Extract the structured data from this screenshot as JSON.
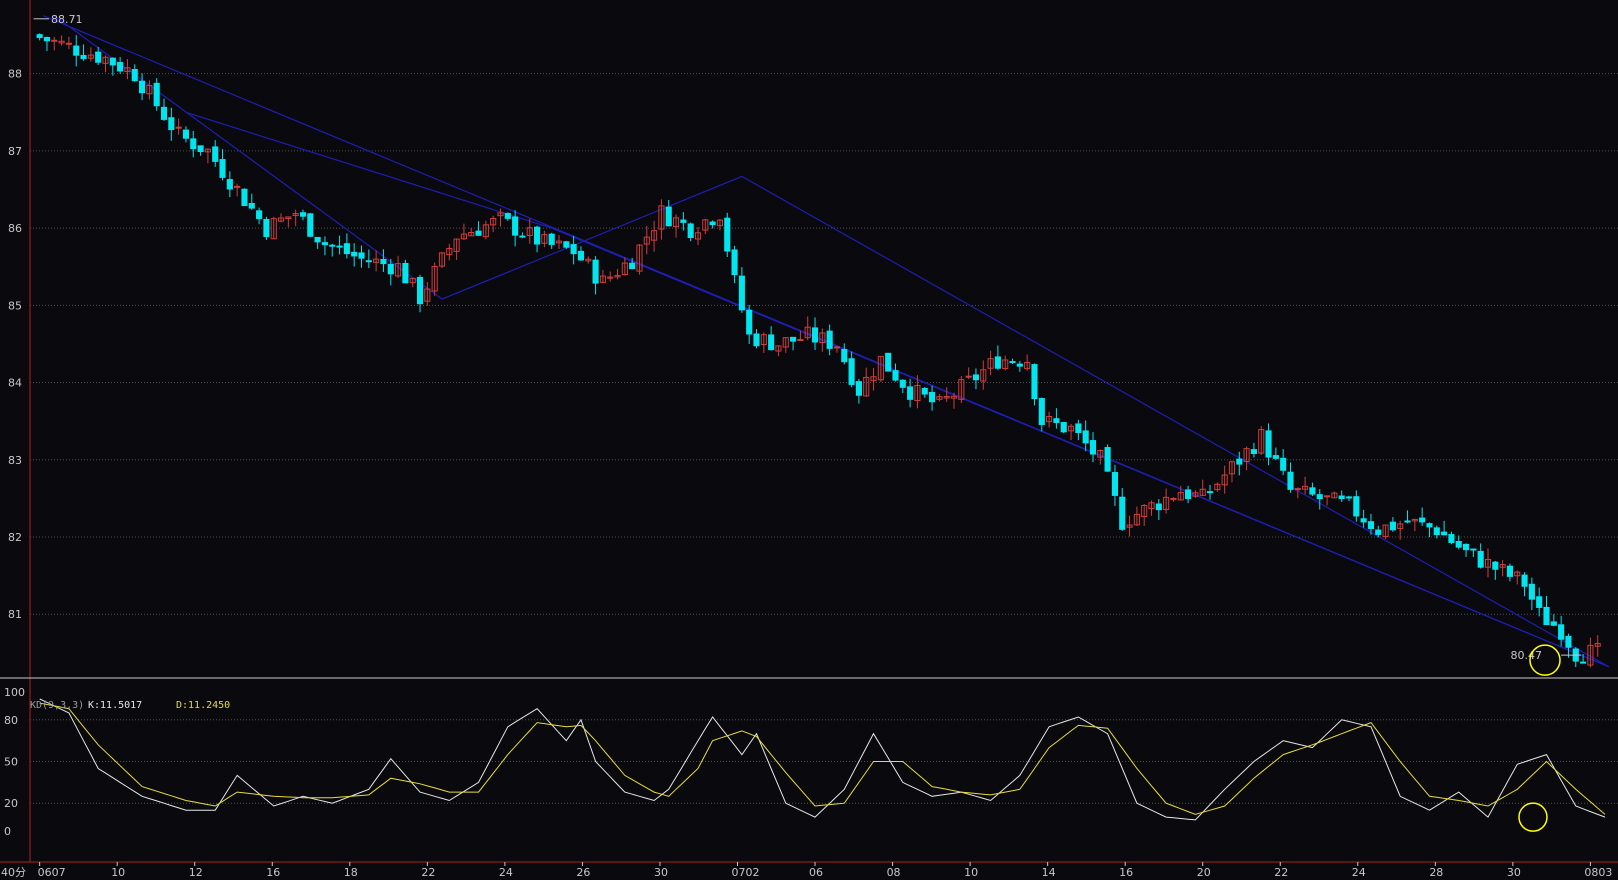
{
  "chart_data": {
    "type": "candlestick",
    "price_panel": {
      "ylim": [
        80.2,
        88.85
      ],
      "y_ticks": [
        81,
        82,
        83,
        84,
        85,
        86,
        87,
        88
      ],
      "annotations": {
        "high_label": "88.71",
        "low_label": "80.47"
      }
    },
    "x_ticks": [
      "0607",
      "10",
      "12",
      "16",
      "18",
      "22",
      "24",
      "26",
      "30",
      "0702",
      "06",
      "08",
      "10",
      "14",
      "16",
      "20",
      "22",
      "24",
      "28",
      "30",
      "0803"
    ],
    "period_label": "40分",
    "price_path": [
      [
        0,
        88.5
      ],
      [
        10,
        88.2
      ],
      [
        14,
        88.0
      ],
      [
        20,
        87.2
      ],
      [
        24,
        87.0
      ],
      [
        28,
        86.5
      ],
      [
        32,
        86.0
      ],
      [
        36,
        86.2
      ],
      [
        40,
        85.8
      ],
      [
        45,
        85.6
      ],
      [
        50,
        85.5
      ],
      [
        53,
        85.1
      ],
      [
        58,
        85.9
      ],
      [
        64,
        86.1
      ],
      [
        70,
        85.8
      ],
      [
        74,
        85.7
      ],
      [
        78,
        85.3
      ],
      [
        82,
        85.6
      ],
      [
        86,
        86.2
      ],
      [
        90,
        86.0
      ],
      [
        94,
        86.2
      ],
      [
        96,
        85.3
      ],
      [
        98,
        84.6
      ],
      [
        102,
        84.5
      ],
      [
        106,
        84.6
      ],
      [
        110,
        84.5
      ],
      [
        113,
        83.9
      ],
      [
        116,
        84.3
      ],
      [
        120,
        83.9
      ],
      [
        124,
        83.7
      ],
      [
        128,
        84.0
      ],
      [
        132,
        84.3
      ],
      [
        136,
        84.3
      ],
      [
        138,
        83.5
      ],
      [
        142,
        83.4
      ],
      [
        146,
        83.0
      ],
      [
        149,
        82.2
      ],
      [
        153,
        82.4
      ],
      [
        157,
        82.6
      ],
      [
        160,
        82.5
      ],
      [
        164,
        82.9
      ],
      [
        168,
        83.3
      ],
      [
        172,
        82.6
      ],
      [
        176,
        82.5
      ],
      [
        180,
        82.4
      ],
      [
        184,
        82.1
      ],
      [
        188,
        82.2
      ],
      [
        192,
        82.1
      ],
      [
        196,
        81.8
      ],
      [
        200,
        81.6
      ],
      [
        204,
        81.4
      ],
      [
        206,
        81.0
      ],
      [
        209,
        80.8
      ],
      [
        211,
        80.5
      ]
    ],
    "trendlines": [
      [
        [
          0.5,
          88.75
        ],
        [
          214.5,
          80.32
        ]
      ],
      [
        [
          2,
          88.75
        ],
        [
          55,
          85.08
        ],
        [
          96,
          86.67
        ],
        [
          214.5,
          80.32
        ]
      ],
      [
        [
          20,
          87.5
        ],
        [
          70,
          86.0
        ],
        [
          214.5,
          80.32
        ]
      ]
    ],
    "kd_panel": {
      "label": "KD(9,3,3)",
      "k_label": "K:11.5017",
      "d_label": "D:11.2450",
      "y_ticks": [
        0,
        20,
        50,
        80,
        100
      ],
      "ylim": [
        -5,
        100
      ],
      "k_path": [
        [
          0,
          95
        ],
        [
          4,
          85
        ],
        [
          8,
          45
        ],
        [
          14,
          25
        ],
        [
          20,
          15
        ],
        [
          24,
          15
        ],
        [
          27,
          40
        ],
        [
          32,
          18
        ],
        [
          36,
          25
        ],
        [
          40,
          20
        ],
        [
          45,
          30
        ],
        [
          48,
          52
        ],
        [
          52,
          28
        ],
        [
          56,
          22
        ],
        [
          60,
          35
        ],
        [
          64,
          75
        ],
        [
          68,
          88
        ],
        [
          72,
          65
        ],
        [
          74,
          80
        ],
        [
          76,
          50
        ],
        [
          80,
          28
        ],
        [
          84,
          22
        ],
        [
          86,
          30
        ],
        [
          90,
          65
        ],
        [
          92,
          82
        ],
        [
          96,
          55
        ],
        [
          98,
          70
        ],
        [
          102,
          20
        ],
        [
          106,
          10
        ],
        [
          110,
          30
        ],
        [
          114,
          70
        ],
        [
          118,
          35
        ],
        [
          122,
          25
        ],
        [
          126,
          28
        ],
        [
          130,
          22
        ],
        [
          134,
          40
        ],
        [
          138,
          75
        ],
        [
          142,
          82
        ],
        [
          146,
          70
        ],
        [
          150,
          20
        ],
        [
          154,
          10
        ],
        [
          158,
          8
        ],
        [
          162,
          30
        ],
        [
          166,
          50
        ],
        [
          170,
          65
        ],
        [
          174,
          60
        ],
        [
          178,
          80
        ],
        [
          182,
          75
        ],
        [
          186,
          25
        ],
        [
          190,
          15
        ],
        [
          194,
          28
        ],
        [
          198,
          10
        ],
        [
          202,
          48
        ],
        [
          206,
          55
        ],
        [
          210,
          18
        ],
        [
          214,
          10
        ]
      ],
      "d_path": [
        [
          0,
          92
        ],
        [
          4,
          88
        ],
        [
          8,
          62
        ],
        [
          14,
          32
        ],
        [
          20,
          22
        ],
        [
          24,
          18
        ],
        [
          27,
          28
        ],
        [
          32,
          25
        ],
        [
          36,
          24
        ],
        [
          40,
          24
        ],
        [
          45,
          26
        ],
        [
          48,
          38
        ],
        [
          52,
          34
        ],
        [
          56,
          28
        ],
        [
          60,
          28
        ],
        [
          64,
          55
        ],
        [
          68,
          78
        ],
        [
          72,
          75
        ],
        [
          74,
          76
        ],
        [
          76,
          65
        ],
        [
          80,
          40
        ],
        [
          84,
          28
        ],
        [
          86,
          25
        ],
        [
          90,
          45
        ],
        [
          92,
          65
        ],
        [
          96,
          72
        ],
        [
          98,
          68
        ],
        [
          102,
          42
        ],
        [
          106,
          18
        ],
        [
          110,
          20
        ],
        [
          114,
          50
        ],
        [
          118,
          50
        ],
        [
          122,
          32
        ],
        [
          126,
          28
        ],
        [
          130,
          26
        ],
        [
          134,
          30
        ],
        [
          138,
          60
        ],
        [
          142,
          76
        ],
        [
          146,
          74
        ],
        [
          150,
          45
        ],
        [
          154,
          20
        ],
        [
          158,
          12
        ],
        [
          162,
          18
        ],
        [
          166,
          38
        ],
        [
          170,
          55
        ],
        [
          174,
          62
        ],
        [
          178,
          70
        ],
        [
          182,
          78
        ],
        [
          186,
          50
        ],
        [
          190,
          25
        ],
        [
          194,
          22
        ],
        [
          198,
          18
        ],
        [
          202,
          30
        ],
        [
          206,
          50
        ],
        [
          210,
          30
        ],
        [
          214,
          12
        ]
      ]
    },
    "colors": {
      "background": "#0a0a0e",
      "up": "#d23c3c",
      "down": "#00e5ee",
      "trendline": "#1e1eb4",
      "grid": "#505050",
      "axis": "#b41e1e",
      "k_line": "#e6e6e6",
      "d_line": "#e6dc3c",
      "marker": "#ffff00"
    }
  }
}
